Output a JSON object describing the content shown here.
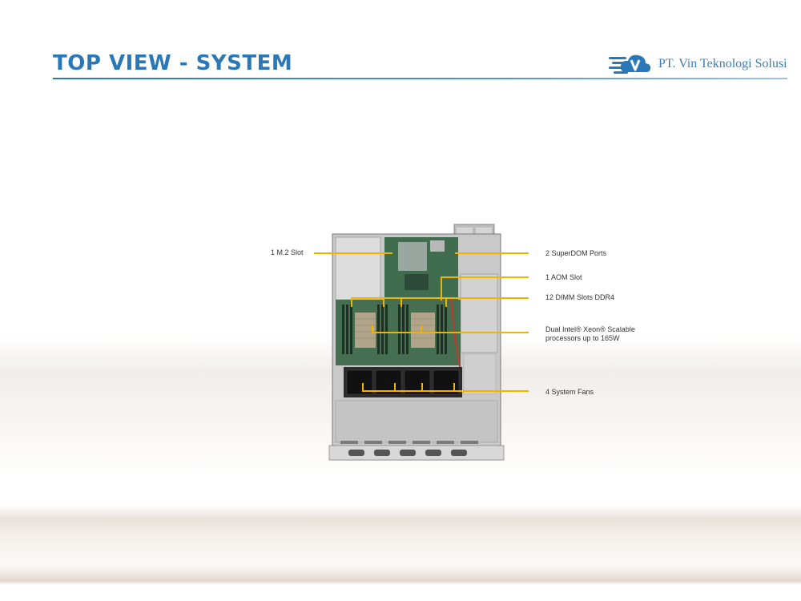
{
  "slide": {
    "title": "TOP VIEW - SYSTEM",
    "company": "PT. Vin Teknologi Solusi",
    "logo_icon": "cloud-v-logo-icon"
  },
  "callouts": {
    "m2_slot": "1 M.2 Slot",
    "superdom": "2 SuperDOM Ports",
    "aom": "1 AOM Slot",
    "dimm": "12 DIMM Slots DDR4",
    "cpu_line1": "Dual Intel® Xeon® Scalable",
    "cpu_line2": "processors up to 165W",
    "fans": "4 System Fans"
  },
  "colors": {
    "title_blue": "#2a78b8",
    "leader_yellow": "#f0b400"
  }
}
